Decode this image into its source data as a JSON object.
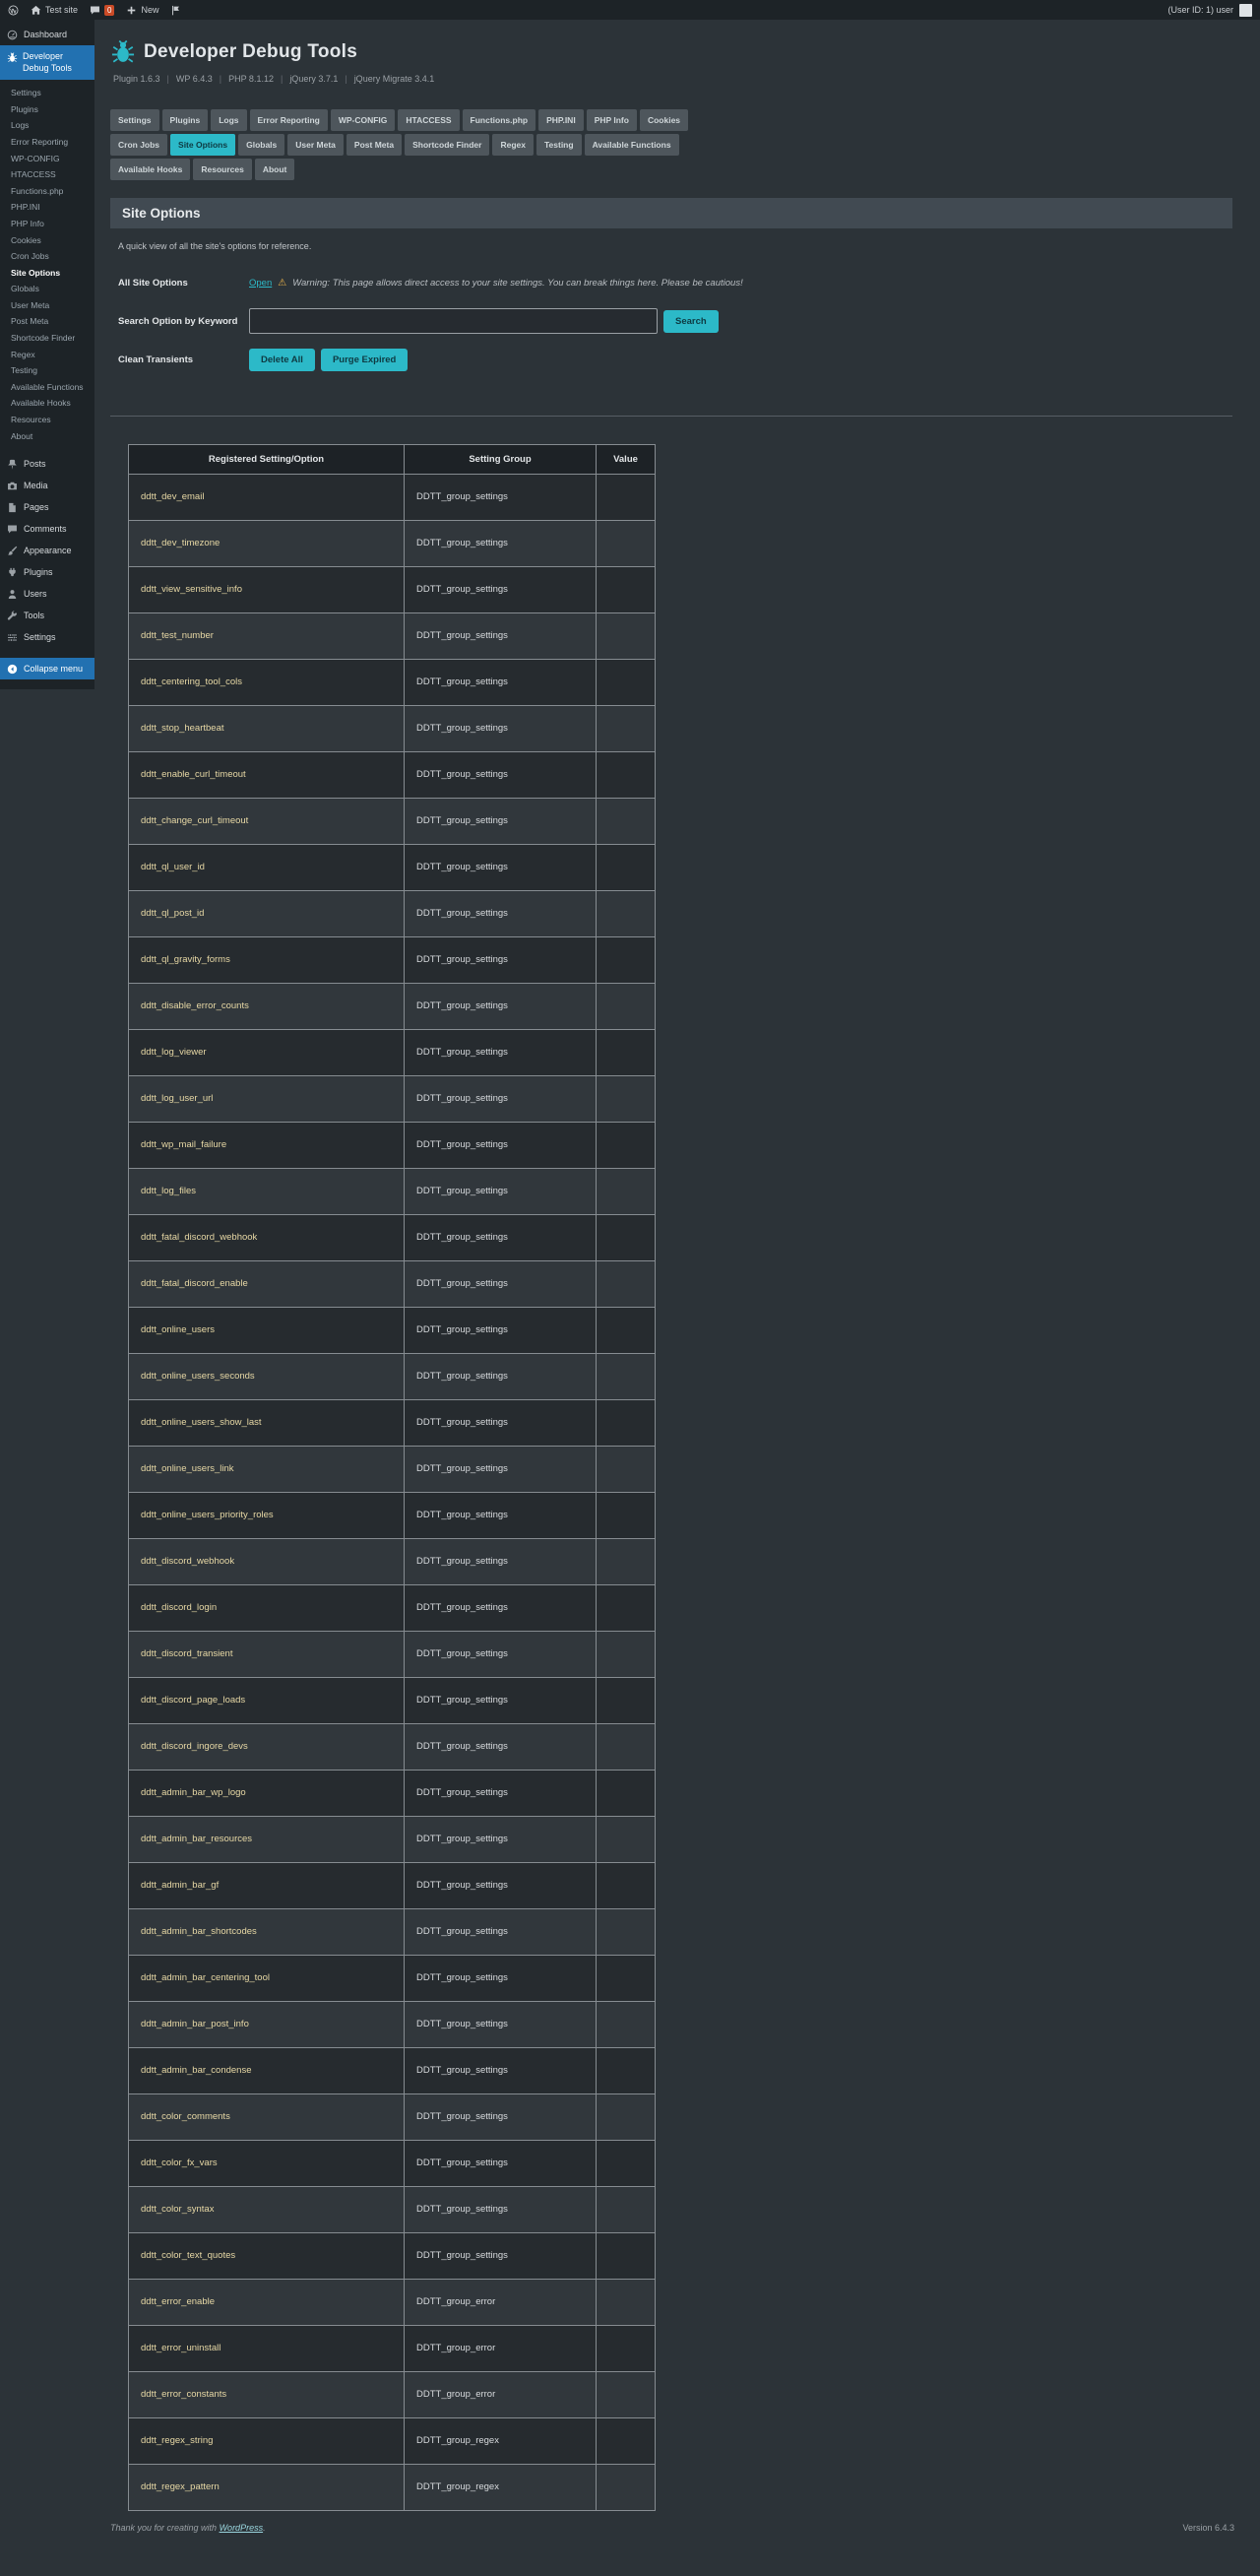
{
  "admin_bar": {
    "items": [
      {
        "icon": "wordpress-logo-icon"
      },
      {
        "icon": "home-icon",
        "label": "Test site"
      },
      {
        "icon": "comment-icon",
        "badge": "0"
      },
      {
        "icon": "plus-icon",
        "label": "New"
      },
      {
        "icon": "flag-icon"
      }
    ],
    "user_info": "(User ID: 1) user"
  },
  "sidebar": {
    "top_items": [
      {
        "label": "Dashboard",
        "icon": "dashboard-icon"
      }
    ],
    "ddtt": {
      "label": "Developer Debug Tools",
      "icon": "bug-icon",
      "submenu": [
        "Settings",
        "Plugins",
        "Logs",
        "Error Reporting",
        "WP-CONFIG",
        "HTACCESS",
        "Functions.php",
        "PHP.INI",
        "PHP Info",
        "Cookies",
        "Cron Jobs",
        "Site Options",
        "Globals",
        "User Meta",
        "Post Meta",
        "Shortcode Finder",
        "Regex",
        "Testing",
        "Available Functions",
        "Available Hooks",
        "Resources",
        "About"
      ],
      "active_submenu": "Site Options"
    },
    "menu_items": [
      {
        "label": "Posts",
        "icon": "pin-icon"
      },
      {
        "label": "Media",
        "icon": "camera-icon"
      },
      {
        "label": "Pages",
        "icon": "pages-icon"
      },
      {
        "label": "Comments",
        "icon": "comment-icon"
      },
      {
        "label": "Appearance",
        "icon": "brush-icon"
      },
      {
        "label": "Plugins",
        "icon": "plugin-icon"
      },
      {
        "label": "Users",
        "icon": "user-icon"
      },
      {
        "label": "Tools",
        "icon": "wrench-icon"
      },
      {
        "label": "Settings",
        "icon": "sliders-icon"
      }
    ],
    "collapse": {
      "label": "Collapse menu",
      "icon": "collapse-icon"
    }
  },
  "header": {
    "title": "Developer Debug Tools",
    "meta": [
      "Plugin 1.6.3",
      "WP 6.4.3",
      "PHP 8.1.12",
      "jQuery 3.7.1",
      "jQuery Migrate 3.4.1"
    ]
  },
  "tabs": {
    "items": [
      "Settings",
      "Plugins",
      "Logs",
      "Error Reporting",
      "WP-CONFIG",
      "HTACCESS",
      "Functions.php",
      "PHP.INI",
      "PHP Info",
      "Cookies",
      "Cron Jobs",
      "Site Options",
      "Globals",
      "User Meta",
      "Post Meta",
      "Shortcode Finder",
      "Regex",
      "Testing",
      "Available Functions",
      "Available Hooks",
      "Resources",
      "About"
    ],
    "active": "Site Options"
  },
  "page": {
    "section_title": "Site Options",
    "description": "A quick view of all the site's options for reference.",
    "all_site_options_label": "All Site Options",
    "open_link": "Open",
    "warning_icon": "⚠",
    "warning_text": "Warning: This page allows direct access to your site settings. You can break things here. Please be cautious!",
    "search_label": "Search Option by Keyword",
    "search_input_value": "",
    "search_button": "Search",
    "clean_transients_label": "Clean Transients",
    "delete_all_button": "Delete All",
    "purge_expired_button": "Purge Expired"
  },
  "table": {
    "headers": [
      "Registered Setting/Option",
      "Setting Group",
      "Value"
    ],
    "rows": [
      {
        "option": "ddtt_dev_email",
        "group": "DDTT_group_settings",
        "value": ""
      },
      {
        "option": "ddtt_dev_timezone",
        "group": "DDTT_group_settings",
        "value": ""
      },
      {
        "option": "ddtt_view_sensitive_info",
        "group": "DDTT_group_settings",
        "value": ""
      },
      {
        "option": "ddtt_test_number",
        "group": "DDTT_group_settings",
        "value": ""
      },
      {
        "option": "ddtt_centering_tool_cols",
        "group": "DDTT_group_settings",
        "value": ""
      },
      {
        "option": "ddtt_stop_heartbeat",
        "group": "DDTT_group_settings",
        "value": ""
      },
      {
        "option": "ddtt_enable_curl_timeout",
        "group": "DDTT_group_settings",
        "value": ""
      },
      {
        "option": "ddtt_change_curl_timeout",
        "group": "DDTT_group_settings",
        "value": ""
      },
      {
        "option": "ddtt_ql_user_id",
        "group": "DDTT_group_settings",
        "value": ""
      },
      {
        "option": "ddtt_ql_post_id",
        "group": "DDTT_group_settings",
        "value": ""
      },
      {
        "option": "ddtt_ql_gravity_forms",
        "group": "DDTT_group_settings",
        "value": ""
      },
      {
        "option": "ddtt_disable_error_counts",
        "group": "DDTT_group_settings",
        "value": ""
      },
      {
        "option": "ddtt_log_viewer",
        "group": "DDTT_group_settings",
        "value": ""
      },
      {
        "option": "ddtt_log_user_url",
        "group": "DDTT_group_settings",
        "value": ""
      },
      {
        "option": "ddtt_wp_mail_failure",
        "group": "DDTT_group_settings",
        "value": ""
      },
      {
        "option": "ddtt_log_files",
        "group": "DDTT_group_settings",
        "value": ""
      },
      {
        "option": "ddtt_fatal_discord_webhook",
        "group": "DDTT_group_settings",
        "value": ""
      },
      {
        "option": "ddtt_fatal_discord_enable",
        "group": "DDTT_group_settings",
        "value": ""
      },
      {
        "option": "ddtt_online_users",
        "group": "DDTT_group_settings",
        "value": ""
      },
      {
        "option": "ddtt_online_users_seconds",
        "group": "DDTT_group_settings",
        "value": ""
      },
      {
        "option": "ddtt_online_users_show_last",
        "group": "DDTT_group_settings",
        "value": ""
      },
      {
        "option": "ddtt_online_users_link",
        "group": "DDTT_group_settings",
        "value": ""
      },
      {
        "option": "ddtt_online_users_priority_roles",
        "group": "DDTT_group_settings",
        "value": ""
      },
      {
        "option": "ddtt_discord_webhook",
        "group": "DDTT_group_settings",
        "value": ""
      },
      {
        "option": "ddtt_discord_login",
        "group": "DDTT_group_settings",
        "value": ""
      },
      {
        "option": "ddtt_discord_transient",
        "group": "DDTT_group_settings",
        "value": ""
      },
      {
        "option": "ddtt_discord_page_loads",
        "group": "DDTT_group_settings",
        "value": ""
      },
      {
        "option": "ddtt_discord_ingore_devs",
        "group": "DDTT_group_settings",
        "value": ""
      },
      {
        "option": "ddtt_admin_bar_wp_logo",
        "group": "DDTT_group_settings",
        "value": ""
      },
      {
        "option": "ddtt_admin_bar_resources",
        "group": "DDTT_group_settings",
        "value": ""
      },
      {
        "option": "ddtt_admin_bar_gf",
        "group": "DDTT_group_settings",
        "value": ""
      },
      {
        "option": "ddtt_admin_bar_shortcodes",
        "group": "DDTT_group_settings",
        "value": ""
      },
      {
        "option": "ddtt_admin_bar_centering_tool",
        "group": "DDTT_group_settings",
        "value": ""
      },
      {
        "option": "ddtt_admin_bar_post_info",
        "group": "DDTT_group_settings",
        "value": ""
      },
      {
        "option": "ddtt_admin_bar_condense",
        "group": "DDTT_group_settings",
        "value": ""
      },
      {
        "option": "ddtt_color_comments",
        "group": "DDTT_group_settings",
        "value": ""
      },
      {
        "option": "ddtt_color_fx_vars",
        "group": "DDTT_group_settings",
        "value": ""
      },
      {
        "option": "ddtt_color_syntax",
        "group": "DDTT_group_settings",
        "value": ""
      },
      {
        "option": "ddtt_color_text_quotes",
        "group": "DDTT_group_settings",
        "value": ""
      },
      {
        "option": "ddtt_error_enable",
        "group": "DDTT_group_error",
        "value": ""
      },
      {
        "option": "ddtt_error_uninstall",
        "group": "DDTT_group_error",
        "value": ""
      },
      {
        "option": "ddtt_error_constants",
        "group": "DDTT_group_error",
        "value": ""
      },
      {
        "option": "ddtt_regex_string",
        "group": "DDTT_group_regex",
        "value": ""
      },
      {
        "option": "ddtt_regex_pattern",
        "group": "DDTT_group_regex",
        "value": ""
      }
    ]
  },
  "footer": {
    "thanks_prefix": "Thank you for creating with ",
    "wordpress_link": "WordPress",
    "thanks_suffix": ".",
    "version": "Version 6.4.3"
  },
  "colors": {
    "accent": "#2cb9c8",
    "menu_highlight": "#2271b1",
    "option_name_text": "#e7d8a5",
    "warning": "#eeb54a",
    "badge": "#cb4b27"
  }
}
